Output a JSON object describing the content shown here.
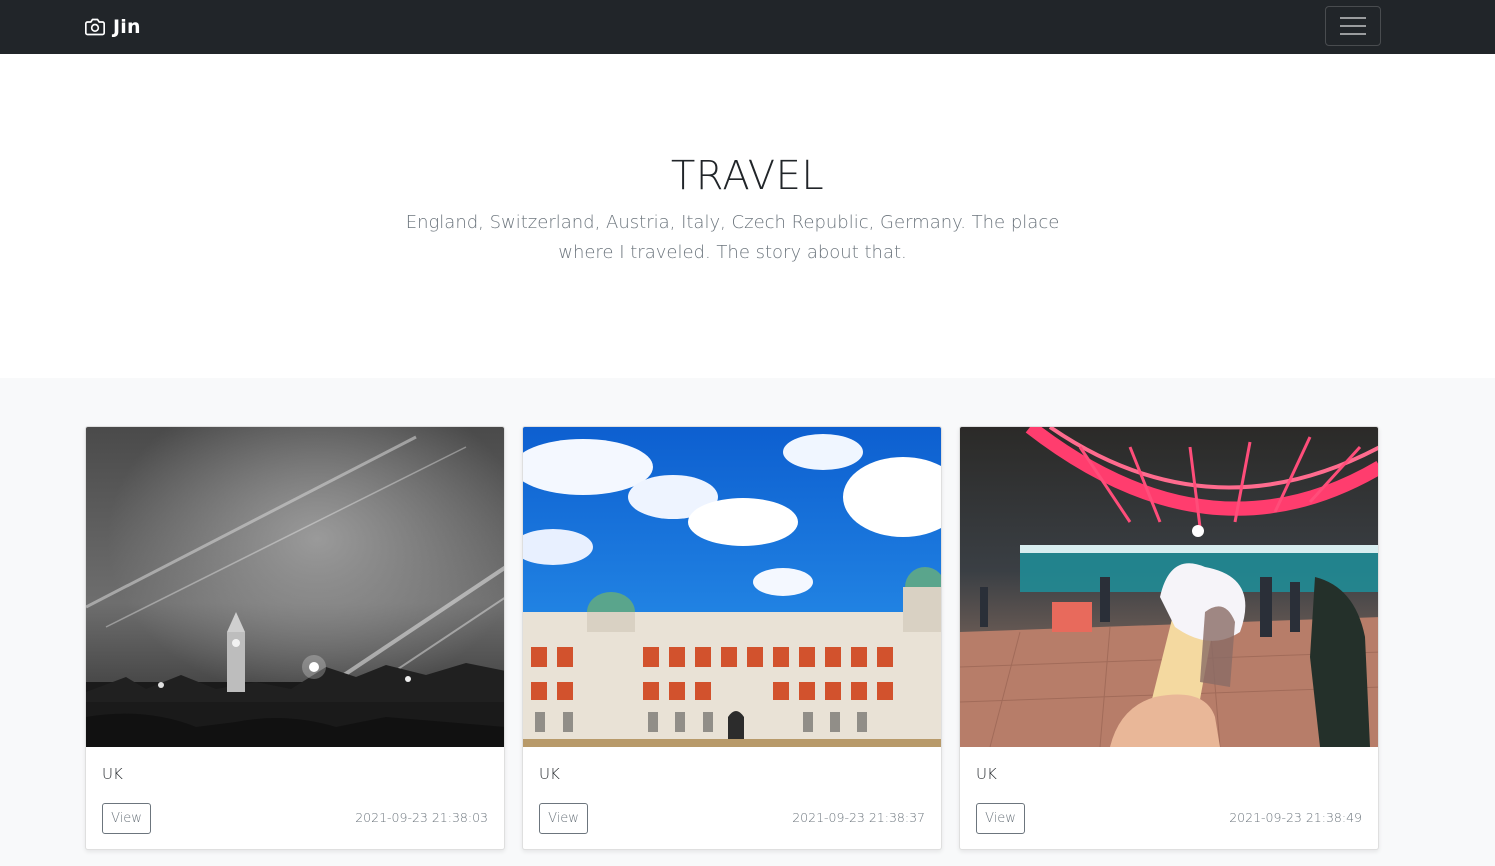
{
  "navbar": {
    "brand": "Jin",
    "brand_icon": "camera-icon",
    "toggler_icon": "hamburger-menu-icon"
  },
  "hero": {
    "title": "TRAVEL",
    "lead": "England, Switzerland, Austria, Italy, Czech Republic, Germany. The place where I traveled. The story about that."
  },
  "cards": [
    {
      "title": "UK",
      "button": "View",
      "time": "2021-09-23 21:38:03",
      "image": "night-london-bridge-big-ben-photo"
    },
    {
      "title": "UK",
      "button": "View",
      "time": "2021-09-23 21:38:37",
      "image": "old-admiralty-building-blue-sky-photo"
    },
    {
      "title": "UK",
      "button": "View",
      "time": "2021-09-23 21:38:49",
      "image": "london-eye-ice-cream-night-photo"
    }
  ],
  "colors": {
    "navbar_bg": "#212529",
    "album_bg": "#f8f9fa",
    "muted_text": "#6c757d"
  }
}
